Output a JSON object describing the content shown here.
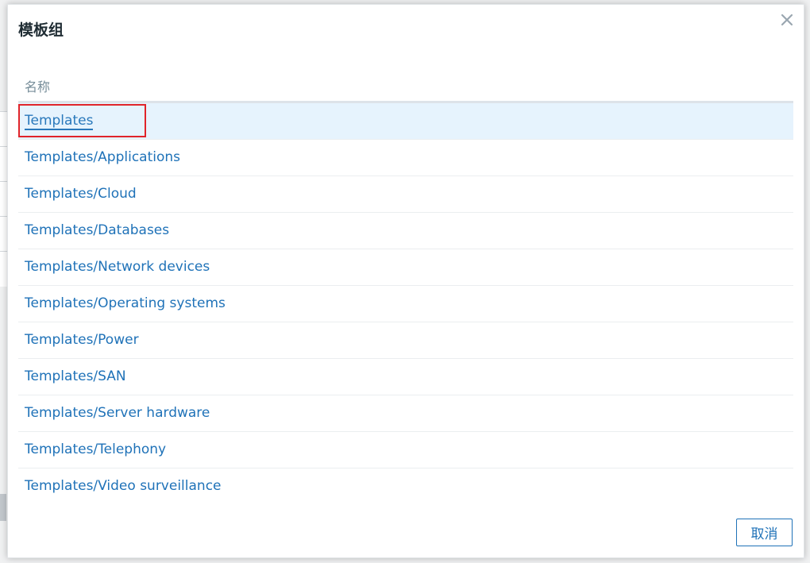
{
  "dialog": {
    "title": "模板组",
    "close_icon": "close-icon",
    "column_header": "名称",
    "rows": [
      {
        "label": "Templates",
        "selected": true
      },
      {
        "label": "Templates/Applications",
        "selected": false
      },
      {
        "label": "Templates/Cloud",
        "selected": false
      },
      {
        "label": "Templates/Databases",
        "selected": false
      },
      {
        "label": "Templates/Network devices",
        "selected": false
      },
      {
        "label": "Templates/Operating systems",
        "selected": false
      },
      {
        "label": "Templates/Power",
        "selected": false
      },
      {
        "label": "Templates/SAN",
        "selected": false
      },
      {
        "label": "Templates/Server hardware",
        "selected": false
      },
      {
        "label": "Templates/Telephony",
        "selected": false
      },
      {
        "label": "Templates/Video surveillance",
        "selected": false
      }
    ],
    "cancel_label": "取消"
  },
  "colors": {
    "link": "#1f72b8",
    "selected_row": "#e6f3fd",
    "highlight": "#e0242a",
    "header_text": "#768d99",
    "title_text": "#1f2c33"
  }
}
